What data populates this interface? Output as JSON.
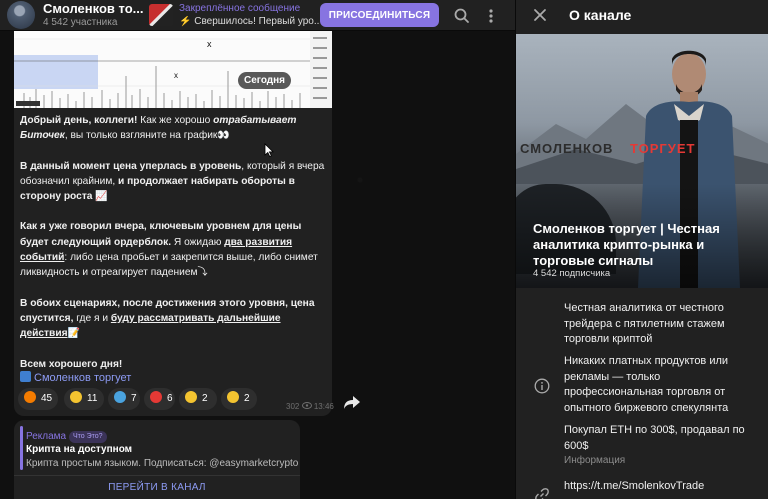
{
  "chat": {
    "header": {
      "title": "Смоленков то...",
      "subtitle": "4 542 участника",
      "pinned_label": "Закреплённое сообщение",
      "pinned_text": "⚡ Свершилось! Первый уро...",
      "join_button": "ПРИСОЕДИНИТЬСЯ",
      "icons": [
        "search-icon",
        "more-vertical-icon"
      ]
    },
    "message": {
      "date_pill": "Сегодня",
      "p1_a": "Добрый день, коллеги!",
      "p1_b": " Как же хорошо ",
      "p1_c": "отрабатывает Биточек",
      "p1_d": ", вы только взгляните на график",
      "p1_e": "👀",
      "p2_a": "В данный момент цена уперлась в уровень",
      "p2_b": ", который я вчера обозначил крайним, ",
      "p2_c": "и продолжает набирать обороты в сторону роста",
      "p2_d": "📈",
      "p3_a": "Как я уже говорил вчера, ключевым уровнем для цены будет следующий ордерблок.",
      "p3_b": " Я ожидаю ",
      "p3_c": "два развития событий",
      "p3_d": ": либо цена пробьет и закрепится выше, либо снимет ликвидность и отреагирует падением",
      "p3_e": "⤵",
      "p4_a": "В обоих сценариях, после достижения этого уровня, цена спустится,",
      "p4_b": " где я и ",
      "p4_c": "буду рассматривать дальнейшие действия",
      "p4_d": "📝",
      "p5": "Всем хорошего дня!",
      "signature": "Смоленков торгует",
      "reactions": [
        {
          "emoji": "🔥",
          "count": "45",
          "color": "#f57c00"
        },
        {
          "emoji": "👍",
          "count": "11",
          "color": "#f4c430"
        },
        {
          "emoji": "🐳",
          "count": "7",
          "color": "#4aa3df"
        },
        {
          "emoji": "❤",
          "count": "6",
          "color": "#e53935"
        },
        {
          "emoji": "👏",
          "count": "2",
          "color": "#f4c430"
        },
        {
          "emoji": "👌",
          "count": "2",
          "color": "#f4c430"
        }
      ],
      "views": "302",
      "time": "13:46",
      "icons": [
        "eye-icon",
        "share-icon"
      ]
    },
    "ad": {
      "label": "Реклама",
      "what_is": "Что Это?",
      "title": "Крипта на доступном",
      "text": "Крипта простым языком. Подписаться: @easymarketcrypto",
      "button": "ПЕРЕЙТИ В КАНАЛ"
    }
  },
  "info": {
    "title": "О канале",
    "icons": [
      "close-icon",
      "info-icon",
      "link-icon"
    ],
    "hero": {
      "brand_word1": "СМОЛЕНКОВ",
      "brand_word2": "ТОРГУЕТ",
      "name": "Смоленков торгует | Честная аналитика крипто-рынка и торговые сигналы",
      "subscribers": "4 542 подписчика"
    },
    "desc1": "Честная аналитика от честного трейдера с пятилетним стажем торговли криптой",
    "desc2": "Никаких платных продуктов или рекламы — только профессиональная торговля от опытного биржевого спекулянта",
    "desc3": "Покупал ETH по 300$, продавал по 600$",
    "caption": "Информация",
    "link": "https://t.me/SmolenkovTrade"
  }
}
